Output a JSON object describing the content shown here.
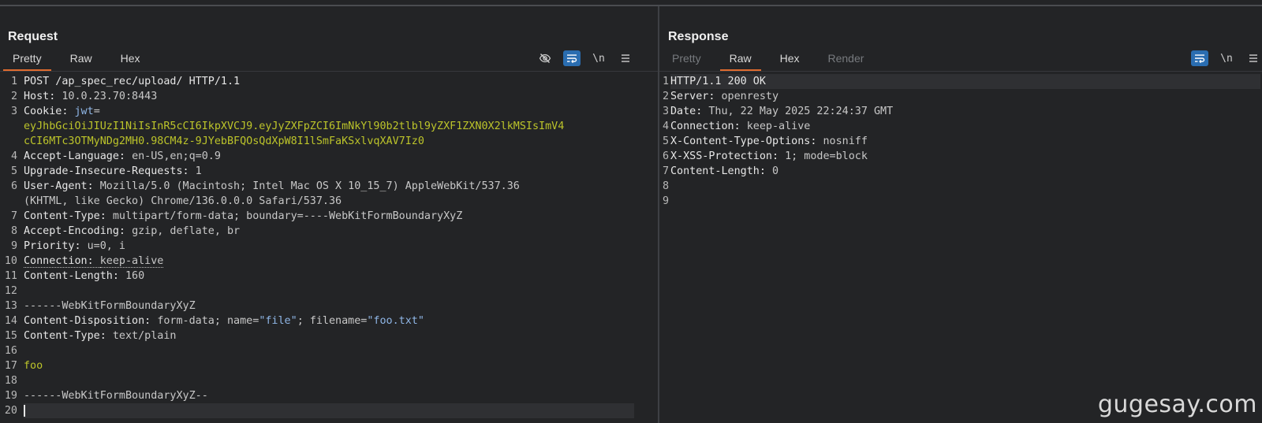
{
  "request": {
    "title": "Request",
    "tabs": [
      "Pretty",
      "Raw",
      "Hex"
    ],
    "active_tab": "Pretty",
    "tools": {
      "hide_icon": "eye-off-icon",
      "wrap_icon": "wrap-lines-icon",
      "newline_label": "\\n",
      "menu_icon": "hamburger-menu-icon"
    },
    "lines": [
      {
        "n": "1",
        "parts": [
          {
            "t": "POST /ap_spec_rec/upload/ HTTP/1.1",
            "c": "k"
          }
        ]
      },
      {
        "n": "2",
        "parts": [
          {
            "t": "Host: ",
            "c": "k"
          },
          {
            "t": "10.0.23.70:8443",
            "c": "val"
          }
        ]
      },
      {
        "n": "3",
        "parts": [
          {
            "t": "Cookie: ",
            "c": "k"
          },
          {
            "t": "jwt",
            "c": "jwtkey"
          },
          {
            "t": "=",
            "c": "val"
          }
        ]
      },
      {
        "n": "",
        "parts": [
          {
            "t": "eyJhbGciOiJIUzI1NiIsInR5cCI6IkpXVCJ9.eyJyZXFpZCI6ImNkYl90b2tlbl9yZXF1ZXN0X2lkMSIsImV4",
            "c": "jwt"
          }
        ]
      },
      {
        "n": "",
        "parts": [
          {
            "t": "cCI6MTc3OTMyNDg2MH0.98CM4z-9JYebBFQOsQdXpW8I1lSmFaKSxlvqXAV7Iz0",
            "c": "jwt"
          }
        ]
      },
      {
        "n": "4",
        "parts": [
          {
            "t": "Accept-Language: ",
            "c": "k"
          },
          {
            "t": "en-US,en;q=0.9",
            "c": "val"
          }
        ]
      },
      {
        "n": "5",
        "parts": [
          {
            "t": "Upgrade-Insecure-Requests: ",
            "c": "k"
          },
          {
            "t": "1",
            "c": "val"
          }
        ]
      },
      {
        "n": "6",
        "parts": [
          {
            "t": "User-Agent: ",
            "c": "k"
          },
          {
            "t": "Mozilla/5.0 (Macintosh; Intel Mac OS X 10_15_7) AppleWebKit/537.36",
            "c": "val"
          }
        ]
      },
      {
        "n": "",
        "parts": [
          {
            "t": "(KHTML, like Gecko) Chrome/136.0.0.0 Safari/537.36",
            "c": "val"
          }
        ]
      },
      {
        "n": "7",
        "parts": [
          {
            "t": "Content-Type: ",
            "c": "k"
          },
          {
            "t": "multipart/form-data; boundary=----WebKitFormBoundaryXyZ",
            "c": "val"
          }
        ]
      },
      {
        "n": "8",
        "parts": [
          {
            "t": "Accept-Encoding: ",
            "c": "k"
          },
          {
            "t": "gzip, deflate, br",
            "c": "val"
          }
        ]
      },
      {
        "n": "9",
        "parts": [
          {
            "t": "Priority: ",
            "c": "k"
          },
          {
            "t": "u=0, i",
            "c": "val"
          }
        ]
      },
      {
        "n": "10",
        "parts": [
          {
            "t": "Connection: ",
            "c": "k dotted"
          },
          {
            "t": "keep-alive",
            "c": "val dotted"
          }
        ]
      },
      {
        "n": "11",
        "parts": [
          {
            "t": "Content-Length: ",
            "c": "k"
          },
          {
            "t": "160",
            "c": "val"
          }
        ]
      },
      {
        "n": "12",
        "parts": []
      },
      {
        "n": "13",
        "parts": [
          {
            "t": "------WebKitFormBoundaryXyZ",
            "c": "val"
          }
        ]
      },
      {
        "n": "14",
        "parts": [
          {
            "t": "Content-Disposition: ",
            "c": "k"
          },
          {
            "t": "form-data; name=",
            "c": "val"
          },
          {
            "t": "\"file\"",
            "c": "str"
          },
          {
            "t": "; filename=",
            "c": "val"
          },
          {
            "t": "\"foo.txt\"",
            "c": "str"
          }
        ]
      },
      {
        "n": "15",
        "parts": [
          {
            "t": "Content-Type: ",
            "c": "k"
          },
          {
            "t": "text/plain",
            "c": "val"
          }
        ]
      },
      {
        "n": "16",
        "parts": []
      },
      {
        "n": "17",
        "parts": [
          {
            "t": "foo",
            "c": "foo"
          }
        ]
      },
      {
        "n": "18",
        "parts": []
      },
      {
        "n": "19",
        "parts": [
          {
            "t": "------WebKitFormBoundaryXyZ--",
            "c": "val"
          }
        ]
      },
      {
        "n": "20",
        "parts": []
      }
    ]
  },
  "response": {
    "title": "Response",
    "tabs": [
      "Pretty",
      "Raw",
      "Hex",
      "Render"
    ],
    "active_tab": "Raw",
    "disabled_tabs": [
      "Pretty",
      "Render"
    ],
    "tools": {
      "wrap_icon": "wrap-lines-icon",
      "newline_label": "\\n",
      "menu_icon": "hamburger-menu-icon"
    },
    "lines": [
      {
        "n": "1",
        "parts": [
          {
            "t": "HTTP/1.1 200 OK",
            "c": "k"
          }
        ]
      },
      {
        "n": "2",
        "parts": [
          {
            "t": "Server: ",
            "c": "k"
          },
          {
            "t": "openresty",
            "c": "val"
          }
        ]
      },
      {
        "n": "3",
        "parts": [
          {
            "t": "Date: ",
            "c": "k"
          },
          {
            "t": "Thu, 22 May 2025 22:24:37 GMT",
            "c": "val"
          }
        ]
      },
      {
        "n": "4",
        "parts": [
          {
            "t": "Connection: ",
            "c": "k"
          },
          {
            "t": "keep-alive",
            "c": "val"
          }
        ]
      },
      {
        "n": "5",
        "parts": [
          {
            "t": "X-Content-Type-Options: ",
            "c": "k"
          },
          {
            "t": "nosniff",
            "c": "val"
          }
        ]
      },
      {
        "n": "6",
        "parts": [
          {
            "t": "X-XSS-Protection: ",
            "c": "k"
          },
          {
            "t": "1; mode=block",
            "c": "val"
          }
        ]
      },
      {
        "n": "7",
        "parts": [
          {
            "t": "Content-Length: ",
            "c": "k"
          },
          {
            "t": "0",
            "c": "val"
          }
        ]
      },
      {
        "n": "8",
        "parts": []
      },
      {
        "n": "9",
        "parts": []
      }
    ]
  },
  "layout_switch": {
    "icons": [
      "split-vertical-icon",
      "split-horizontal-icon",
      "single-pane-icon"
    ],
    "active": "split-vertical-icon"
  },
  "watermark": "gugesay.com",
  "colors": {
    "accent_tab": "#e06c2f",
    "active_button": "#2a6db0",
    "jwt": "#bcc42a",
    "string": "#8fb6e6"
  }
}
